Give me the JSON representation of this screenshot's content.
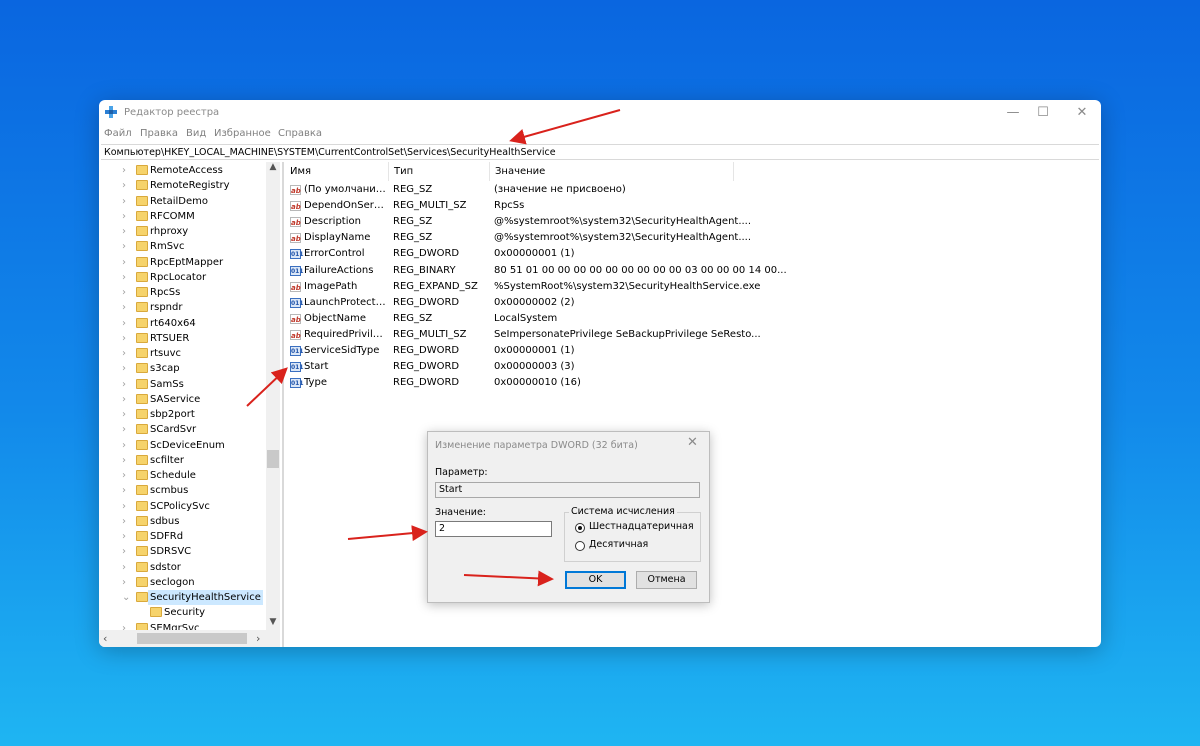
{
  "window": {
    "title": "Редактор реестра",
    "controls": {
      "minimize": "—",
      "maximize": "☐",
      "close": "✕"
    }
  },
  "menu": [
    "Файл",
    "Правка",
    "Вид",
    "Избранное",
    "Справка"
  ],
  "address": "Компьютер\\HKEY_LOCAL_MACHINE\\SYSTEM\\CurrentControlSet\\Services\\SecurityHealthService",
  "tree": {
    "items": [
      "RemoteAccess",
      "RemoteRegistry",
      "RetailDemo",
      "RFCOMM",
      "rhproxy",
      "RmSvc",
      "RpcEptMapper",
      "RpcLocator",
      "RpcSs",
      "rspndr",
      "rt640x64",
      "RTSUER",
      "rtsuvc",
      "s3cap",
      "SamSs",
      "SAService",
      "sbp2port",
      "SCardSvr",
      "ScDeviceEnum",
      "scfilter",
      "Schedule",
      "scmbus",
      "SCPolicySvc",
      "sdbus",
      "SDFRd",
      "SDRSVC",
      "sdstor",
      "seclogon",
      "SecurityHealthService",
      "Security",
      "SEMgrSvc"
    ],
    "expanded_item": "SecurityHealthService",
    "child_item": "Security"
  },
  "columns": {
    "name": "Имя",
    "type": "Тип",
    "value": "Значение"
  },
  "values": [
    {
      "icon": "string-value-icon",
      "name": "(По умолчанию)",
      "type": "REG_SZ",
      "data": "(значение не присвоено)"
    },
    {
      "icon": "string-value-icon",
      "name": "DependOnService",
      "type": "REG_MULTI_SZ",
      "data": "RpcSs"
    },
    {
      "icon": "string-value-icon",
      "name": "Description",
      "type": "REG_SZ",
      "data": "@%systemroot%\\system32\\SecurityHealthAgent...."
    },
    {
      "icon": "string-value-icon",
      "name": "DisplayName",
      "type": "REG_SZ",
      "data": "@%systemroot%\\system32\\SecurityHealthAgent...."
    },
    {
      "icon": "binary-value-icon",
      "name": "ErrorControl",
      "type": "REG_DWORD",
      "data": "0x00000001 (1)"
    },
    {
      "icon": "binary-value-icon",
      "name": "FailureActions",
      "type": "REG_BINARY",
      "data": "80 51 01 00 00 00 00 00 00 00 00 00 03 00 00 00 14 00..."
    },
    {
      "icon": "string-value-icon",
      "name": "ImagePath",
      "type": "REG_EXPAND_SZ",
      "data": "%SystemRoot%\\system32\\SecurityHealthService.exe"
    },
    {
      "icon": "binary-value-icon",
      "name": "LaunchProtected",
      "type": "REG_DWORD",
      "data": "0x00000002 (2)"
    },
    {
      "icon": "string-value-icon",
      "name": "ObjectName",
      "type": "REG_SZ",
      "data": "LocalSystem"
    },
    {
      "icon": "string-value-icon",
      "name": "RequiredPrivileg...",
      "type": "REG_MULTI_SZ",
      "data": "SeImpersonatePrivilege SeBackupPrivilege SeResto..."
    },
    {
      "icon": "binary-value-icon",
      "name": "ServiceSidType",
      "type": "REG_DWORD",
      "data": "0x00000001 (1)"
    },
    {
      "icon": "binary-value-icon",
      "name": "Start",
      "type": "REG_DWORD",
      "data": "0x00000003 (3)"
    },
    {
      "icon": "binary-value-icon",
      "name": "Type",
      "type": "REG_DWORD",
      "data": "0x00000010 (16)"
    }
  ],
  "icon_glyphs": {
    "string": "ab",
    "binary": "011"
  },
  "dialog": {
    "title": "Изменение параметра DWORD (32 бита)",
    "close": "✕",
    "param_label": "Параметр:",
    "param_value": "Start",
    "value_label": "Значение:",
    "value_input": "2",
    "radix_label": "Система исчисления",
    "radix_options": [
      {
        "label": "Шестнадцатеричная",
        "selected": true
      },
      {
        "label": "Десятичная",
        "selected": false
      }
    ],
    "ok_label": "OK",
    "cancel_label": "Отмена"
  },
  "colors": {
    "annotation_arrow": "#d9221c",
    "selection": "#cce8ff",
    "folder": "#f6d36b",
    "background_top": "#0a66e0",
    "background_bottom": "#1fb5f2"
  }
}
